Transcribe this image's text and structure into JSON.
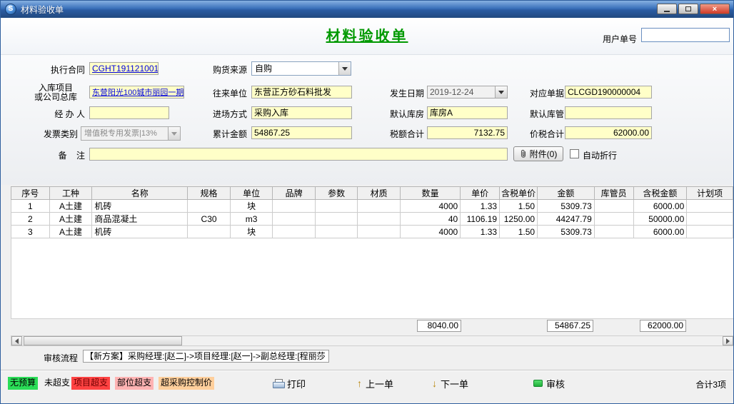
{
  "colors": {
    "title_green": "#009900",
    "field_yellow": "#ffffc8",
    "link_blue": "#0000dd",
    "row_pink": "#fadcdc",
    "row_selected": "#ef8478",
    "badge_green": "#2add57",
    "badge_red": "#ff4242",
    "badge_pink": "#ffb3b3",
    "badge_orange": "#ffcf9c"
  },
  "window": {
    "title": "材料验收单",
    "close_glyph": "×"
  },
  "header": {
    "form_title": "材料验收单",
    "user_order_no_label": "用户单号",
    "user_order_no_value": ""
  },
  "form": {
    "contract": {
      "label": "执行合同",
      "value": "CGHT191121001"
    },
    "purchase_source": {
      "label": "购货来源",
      "value": "自购"
    },
    "project": {
      "label_line1": "入库项目",
      "label_line2": "或公司总库",
      "value": "东营阳光100城市丽园一期"
    },
    "counterpart": {
      "label": "往来单位",
      "value": "东营正方砂石料批发"
    },
    "occur_date": {
      "label": "发生日期",
      "value": "2019-12-24"
    },
    "ref_doc": {
      "label": "对应单据",
      "value": "CLCGD190000004"
    },
    "handler": {
      "label": "经 办 人",
      "value": ""
    },
    "entry_mode": {
      "label": "进场方式",
      "value": "采购入库"
    },
    "default_warehouse": {
      "label": "默认库房",
      "value": "库房A"
    },
    "default_keeper": {
      "label": "默认库管",
      "value": ""
    },
    "invoice_type": {
      "label": "发票类别",
      "value": "增值税专用发票|13%"
    },
    "accum_amount": {
      "label": "累计金额",
      "value": "54867.25"
    },
    "tax_total": {
      "label": "税额合计",
      "value": "7132.75"
    },
    "gross_total": {
      "label": "价税合计",
      "value": "62000.00"
    },
    "remark": {
      "label": "备    注",
      "value": ""
    },
    "attachment_button": "附件(0)",
    "auto_wrap_label": "自动折行"
  },
  "table": {
    "columns": [
      "序号",
      "工种",
      "名称",
      "规格",
      "单位",
      "品牌",
      "参数",
      "材质",
      "数量",
      "单价",
      "含税单价",
      "金额",
      "库管员",
      "含税金额",
      "计划项"
    ],
    "rows": [
      {
        "state": "pink",
        "cells": [
          "1",
          "A土建",
          "机砖",
          "",
          "块",
          "",
          "",
          "",
          "4000",
          "1.33",
          "1.50",
          "5309.73",
          "",
          "6000.00",
          ""
        ]
      },
      {
        "state": "white",
        "cells": [
          "2",
          "A土建",
          "商品混凝土",
          "C30",
          "m3",
          "",
          "",
          "",
          "40",
          "1106.19",
          "1250.00",
          "44247.79",
          "",
          "50000.00",
          ""
        ]
      },
      {
        "state": "selected",
        "cells": [
          "3",
          "A土建",
          "机砖",
          "",
          "块",
          "",
          "",
          "",
          "4000",
          "1.33",
          "1.50",
          "5309.73",
          "",
          "6000.00",
          ""
        ]
      }
    ],
    "totals": {
      "quantity": "8040.00",
      "amount": "54867.25",
      "tax_amount": "62000.00"
    }
  },
  "review": {
    "label": "审核流程",
    "value": "【新方案】采购经理:[赵二]->项目经理:[赵一]->副总经理:[程丽莎"
  },
  "footer": {
    "badges": [
      {
        "label": "无预算",
        "type": "green"
      },
      {
        "label": "未超支",
        "type": "plain"
      },
      {
        "label": "项目超支",
        "type": "red"
      },
      {
        "label": "部位超支",
        "type": "pink"
      },
      {
        "label": "超采购控制价",
        "type": "orange"
      }
    ],
    "print_button": "打印",
    "prev_button": "上一单",
    "next_button": "下一单",
    "audit_button": "审核",
    "total_count": "合计3项"
  }
}
